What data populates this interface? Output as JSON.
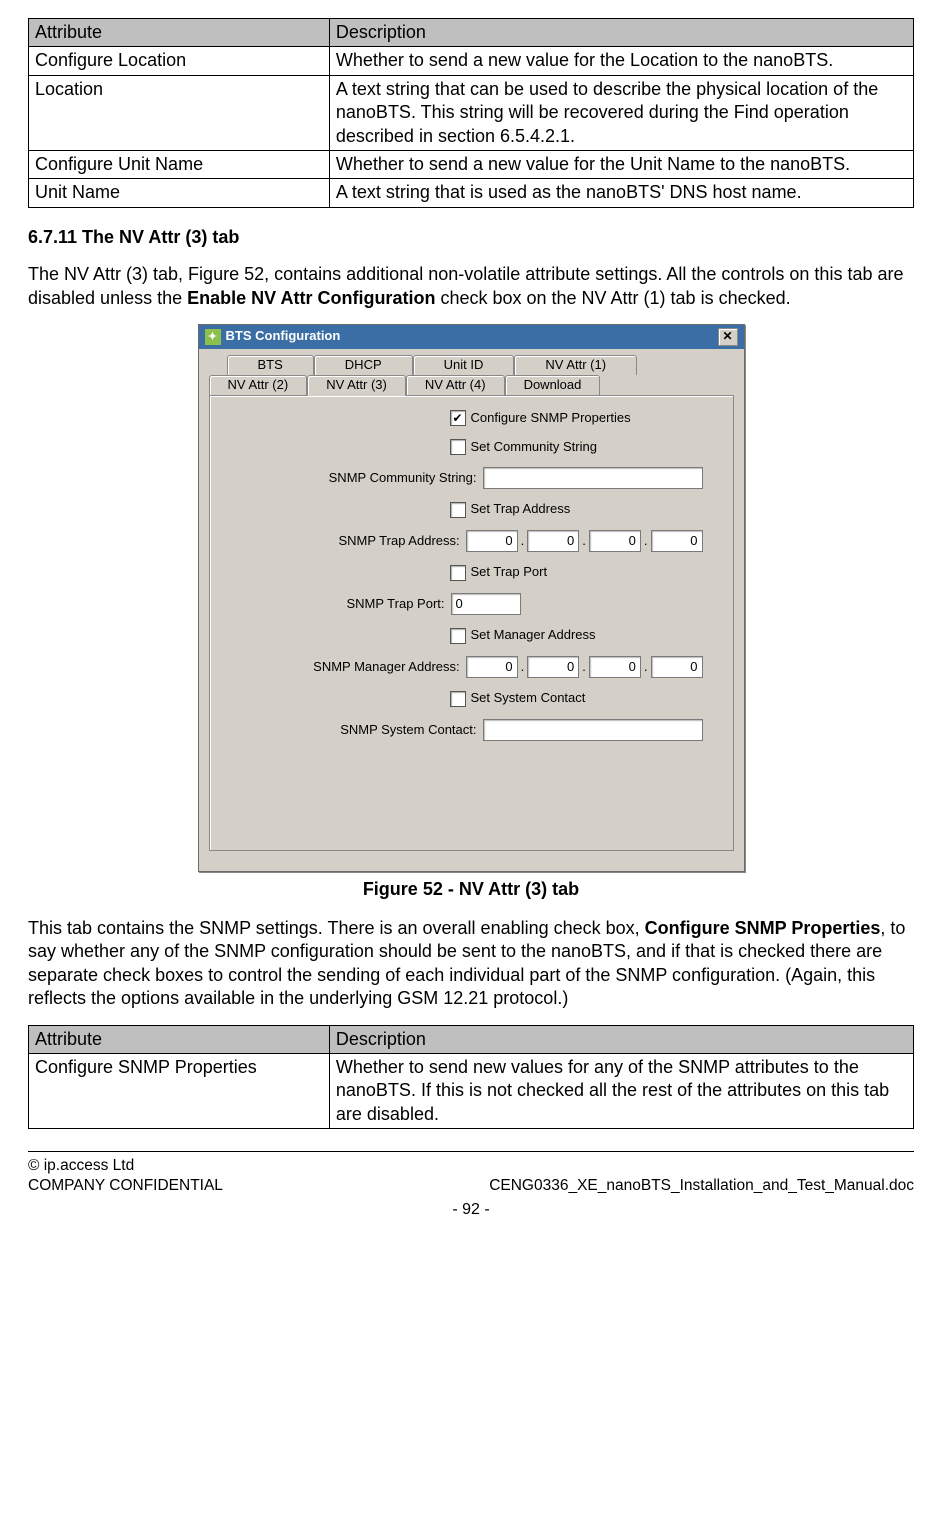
{
  "table1": {
    "headers": [
      "Attribute",
      "Description"
    ],
    "rows": [
      [
        "Configure Location",
        "Whether to send a new value for the Location to the nanoBTS."
      ],
      [
        "Location",
        "A text string that can be used to describe the physical location of the nanoBTS. This string will be recovered during the Find operation described in section 6.5.4.2.1."
      ],
      [
        "Configure Unit Name",
        "Whether to send a new value for the Unit Name to the nanoBTS."
      ],
      [
        "Unit Name",
        "A text string that is used as the nanoBTS' DNS host name."
      ]
    ]
  },
  "section_heading": "6.7.11 The NV Attr (3) tab",
  "para1_parts": {
    "p1": "The NV Attr (3) tab, Figure 52, contains additional non-volatile attribute settings. All the controls on this tab are disabled unless the ",
    "bold": "Enable NV Attr Configuration",
    "p2": " check box on the NV Attr (1) tab is checked."
  },
  "dialog": {
    "title": "BTS Configuration",
    "tabs_top": [
      "BTS",
      "DHCP",
      "Unit ID",
      "NV Attr (1)"
    ],
    "tabs_bottom": [
      "NV Attr (2)",
      "NV Attr (3)",
      "NV Attr (4)",
      "Download"
    ],
    "active_tab": "NV Attr (3)",
    "chk_configure": "Configure SNMP Properties",
    "chk_set_community": "Set Community String",
    "lbl_community": "SNMP Community String:",
    "chk_set_trap_addr": "Set Trap Address",
    "lbl_trap_addr": "SNMP Trap Address:",
    "chk_set_trap_port": "Set Trap Port",
    "lbl_trap_port": "SNMP Trap Port:",
    "val_trap_port": "0",
    "chk_set_mgr_addr": "Set Manager Address",
    "lbl_mgr_addr": "SNMP Manager Address:",
    "chk_set_sys_contact": "Set System Contact",
    "lbl_sys_contact": "SNMP System Contact:",
    "ip_zero": "0"
  },
  "figure_caption": "Figure 52 - NV Attr (3) tab",
  "para2_parts": {
    "p1": "This tab contains the SNMP settings. There is an overall enabling check box, ",
    "bold": "Configure SNMP Properties",
    "p2": ", to say whether any of the SNMP configuration should be sent to the nanoBTS, and if that is checked there are separate check boxes to control the sending of each individual part of the SNMP configuration. (Again, this reflects the options available in the underlying GSM 12.21 protocol.)"
  },
  "table2": {
    "headers": [
      "Attribute",
      "Description"
    ],
    "rows": [
      [
        "Configure SNMP Properties",
        "Whether to send new values for any of the SNMP attributes to the nanoBTS. If this is not checked all the rest of the attributes on this tab are disabled."
      ]
    ]
  },
  "footer": {
    "copyright": "© ip.access Ltd",
    "confidential": "COMPANY CONFIDENTIAL",
    "docref": "CENG0336_XE_nanoBTS_Installation_and_Test_Manual.doc",
    "page": "- 92 -"
  }
}
